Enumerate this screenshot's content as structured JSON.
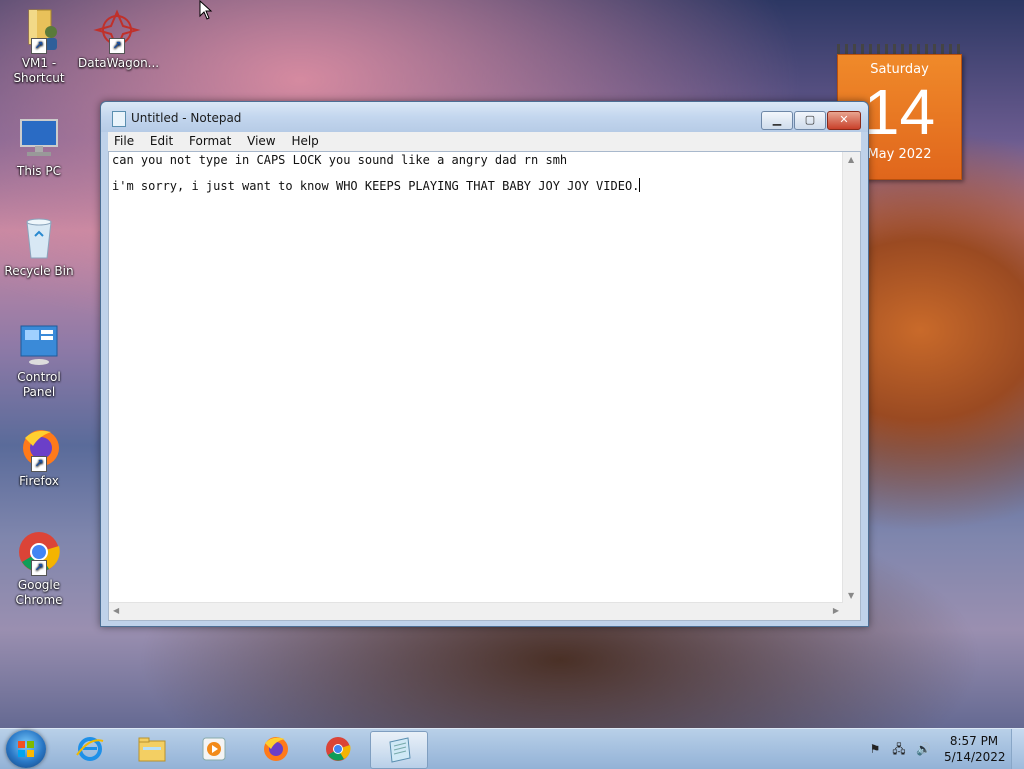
{
  "desktop": {
    "icons": [
      {
        "label": "VM1 - Shortcut",
        "icon": "folder-user-icon"
      },
      {
        "label": "DataWagon...",
        "icon": "datawagon-icon"
      },
      {
        "label": "This PC",
        "icon": "computer-icon"
      },
      {
        "label": "Recycle Bin",
        "icon": "recycle-bin-icon"
      },
      {
        "label": "Control Panel",
        "icon": "control-panel-icon"
      },
      {
        "label": "Firefox",
        "icon": "firefox-icon"
      },
      {
        "label": "Google Chrome",
        "icon": "chrome-icon"
      }
    ]
  },
  "calendar": {
    "weekday": "Saturday",
    "day": "14",
    "month_year": "May 2022"
  },
  "notepad": {
    "title": "Untitled - Notepad",
    "menu": [
      "File",
      "Edit",
      "Format",
      "View",
      "Help"
    ],
    "lines": [
      "can you not type in CAPS LOCK you sound like a angry dad rn smh",
      "i'm sorry, i just want to know WHO KEEPS PLAYING THAT BABY JOY JOY VIDEO."
    ]
  },
  "taskbar": {
    "pinned": [
      "internet-explorer-icon",
      "file-explorer-icon",
      "media-player-icon",
      "firefox-icon",
      "chrome-icon",
      "notepad-icon"
    ],
    "clock_time": "8:57 PM",
    "clock_date": "5/14/2022"
  }
}
